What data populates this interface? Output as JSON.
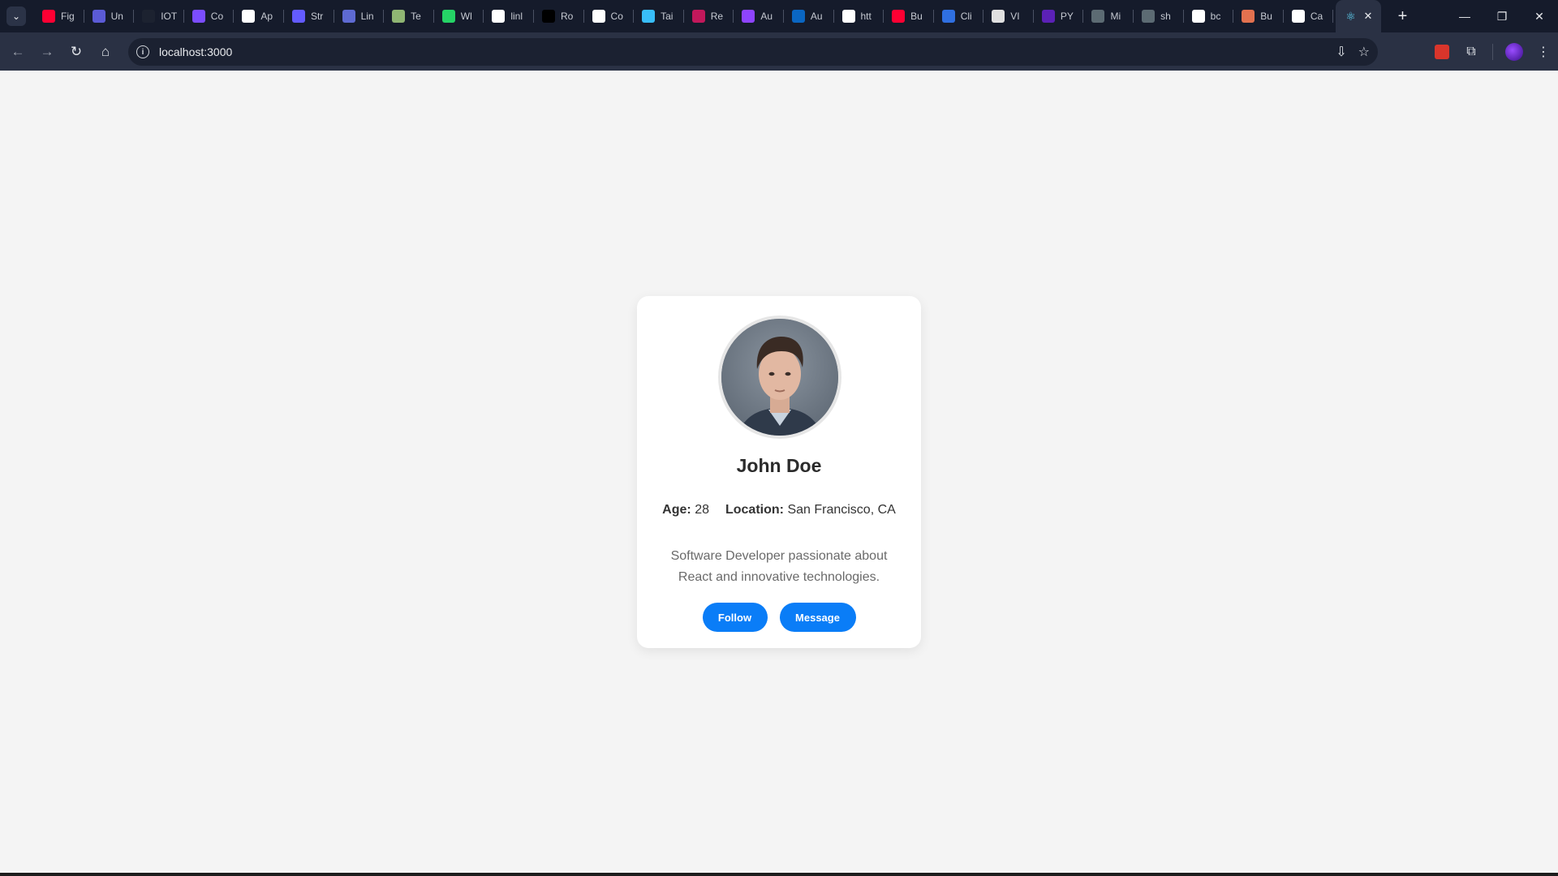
{
  "browser": {
    "tabs": [
      {
        "title": "Fig",
        "icon": "youtube-icon",
        "color": "#ff0033"
      },
      {
        "title": "Un",
        "icon": "chart-icon",
        "color": "#5b5bd6"
      },
      {
        "title": "IOT",
        "icon": "iot-icon",
        "color": "#1c2230"
      },
      {
        "title": "Co",
        "icon": "w-icon",
        "color": "#7b4dff"
      },
      {
        "title": "Ap",
        "icon": "app-icon",
        "color": "#ffffff"
      },
      {
        "title": "Str",
        "icon": "s-icon",
        "color": "#635bff"
      },
      {
        "title": "Lin",
        "icon": "linear-icon",
        "color": "#5e6ad2"
      },
      {
        "title": "Te",
        "icon": "globe-icon",
        "color": "#8fb573"
      },
      {
        "title": "Wl",
        "icon": "whatsapp-icon",
        "color": "#25d366"
      },
      {
        "title": "linl",
        "icon": "github-icon",
        "color": "#ffffff"
      },
      {
        "title": "Ro",
        "icon": "next-icon",
        "color": "#000000"
      },
      {
        "title": "Co",
        "icon": "github-icon",
        "color": "#ffffff"
      },
      {
        "title": "Tai",
        "icon": "tailwind-icon",
        "color": "#38bdf8"
      },
      {
        "title": "Re",
        "icon": "redux-icon",
        "color": "#c2185b"
      },
      {
        "title": "Au",
        "icon": "shield-icon",
        "color": "#8e44ff"
      },
      {
        "title": "Au",
        "icon": "linkedin-icon",
        "color": "#0a66c2"
      },
      {
        "title": "htt",
        "icon": "google-icon",
        "color": "#ffffff"
      },
      {
        "title": "Bu",
        "icon": "youtube-icon",
        "color": "#ff0033"
      },
      {
        "title": "Cli",
        "icon": "shield-icon",
        "color": "#2f6fe0"
      },
      {
        "title": "VI",
        "icon": "doc-icon",
        "color": "#e0e0e0"
      },
      {
        "title": "PY",
        "icon": "dot-icon",
        "color": "#5b21b6"
      },
      {
        "title": "Mi",
        "icon": "chart-outline-icon",
        "color": "#5c6b73"
      },
      {
        "title": "sh",
        "icon": "chart-outline-icon",
        "color": "#5c6b73"
      },
      {
        "title": "bc",
        "icon": "github-icon",
        "color": "#ffffff"
      },
      {
        "title": "Bu",
        "icon": "claude-icon",
        "color": "#e2714f"
      },
      {
        "title": "Ca",
        "icon": "openai-icon",
        "color": "#ffffff"
      }
    ],
    "active_tab_icon": "react-icon",
    "url": "localhost:3000"
  },
  "profile": {
    "name": "John Doe",
    "age_label": "Age:",
    "age": "28",
    "location_label": "Location:",
    "location": "San Francisco, CA",
    "bio": "Software Developer passionate about React and innovative technologies.",
    "follow_label": "Follow",
    "message_label": "Message",
    "button_color": "#0a7df7"
  }
}
